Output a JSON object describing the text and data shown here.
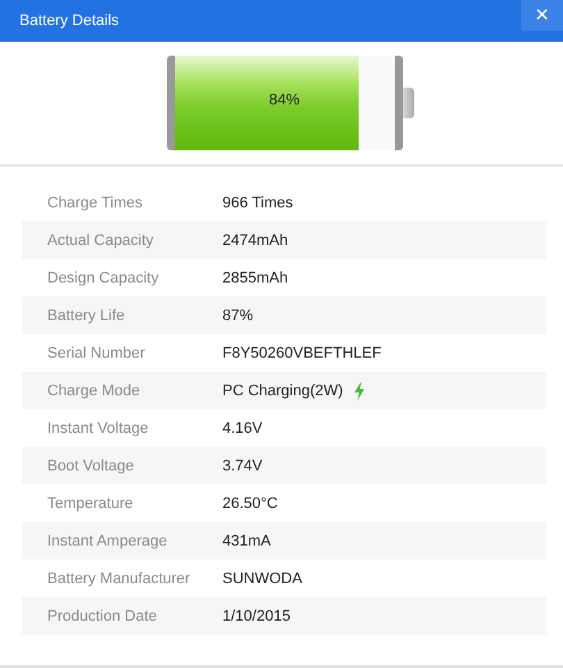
{
  "window": {
    "title": "Battery Details",
    "close": "✕"
  },
  "battery": {
    "level": 0.84,
    "reading": "84%"
  },
  "details": [
    {
      "label": "Charge Times",
      "value": "966 Times",
      "charging": false
    },
    {
      "label": "Actual Capacity",
      "value": "2474mAh",
      "charging": false
    },
    {
      "label": "Design Capacity",
      "value": "2855mAh",
      "charging": false
    },
    {
      "label": "Battery Life",
      "value": "87%",
      "charging": false
    },
    {
      "label": "Serial Number",
      "value": "F8Y50260VBEFTHLEF",
      "charging": false
    },
    {
      "label": "Charge Mode",
      "value": "PC Charging(2W)",
      "charging": true
    },
    {
      "label": "Instant Voltage",
      "value": "4.16V",
      "charging": false
    },
    {
      "label": "Boot Voltage",
      "value": "3.74V",
      "charging": false
    },
    {
      "label": "Temperature",
      "value": "26.50°C",
      "charging": false
    },
    {
      "label": "Instant Amperage",
      "value": "431mA",
      "charging": false
    },
    {
      "label": "Battery Manufacturer",
      "value": "SUNWODA",
      "charging": false
    },
    {
      "label": "Production Date",
      "value": "1/10/2015",
      "charging": false
    }
  ]
}
